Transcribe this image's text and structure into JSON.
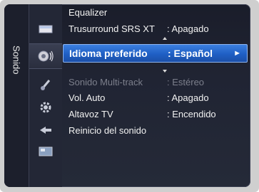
{
  "side": {
    "title": "Sonido"
  },
  "icons": [
    {
      "name": "picture-icon"
    },
    {
      "name": "sound-icon"
    },
    {
      "name": "channel-icon"
    },
    {
      "name": "setup-icon"
    },
    {
      "name": "input-icon"
    },
    {
      "name": "application-icon"
    }
  ],
  "menu": {
    "items": [
      {
        "label": "Equalizer",
        "value": ""
      },
      {
        "label": "Trusurround SRS XT",
        "value": ": Apagado"
      },
      {
        "label": "Idioma preferido",
        "value": ": Español",
        "selected": true
      },
      {
        "label": "Sonido Multi-track",
        "value": ": Estéreo",
        "disabled": true
      },
      {
        "label": "Vol. Auto",
        "value": ": Apagado"
      },
      {
        "label": "Altavoz TV",
        "value": ": Encendido"
      },
      {
        "label": "Reinicio del sonido",
        "value": ""
      }
    ],
    "submenu_arrow": "►"
  },
  "colors": {
    "highlight": "#2a6fd6",
    "background": "#1f2331",
    "disabled_text": "#7c7f8c"
  }
}
